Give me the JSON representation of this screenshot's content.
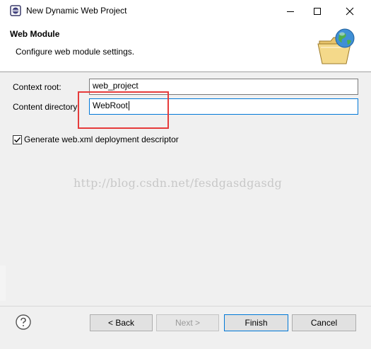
{
  "window": {
    "title": "New Dynamic Web Project",
    "minimize_icon": "minimize-icon",
    "maximize_icon": "maximize-icon",
    "close_icon": "close-icon"
  },
  "banner": {
    "title": "Web Module",
    "description": "Configure web module settings.",
    "icon": "web-folder-globe-icon"
  },
  "form": {
    "context_root_label": "Context root:",
    "context_root_value": "web_project",
    "content_directory_label": "Content directory:",
    "content_directory_value": "WebRoot",
    "generate_checkbox_label": "Generate web.xml deployment descriptor",
    "generate_checkbox_checked": true
  },
  "overlay": {
    "watermark": "http://blog.csdn.net/fesdgasdgasdg",
    "highlight_color": "#e63b3b"
  },
  "footer": {
    "help_icon": "help-icon",
    "back_label": "< Back",
    "next_label": "Next >",
    "finish_label": "Finish",
    "cancel_label": "Cancel"
  },
  "colors": {
    "accent": "#0078d7",
    "dialog_bg": "#f0f0f0"
  }
}
